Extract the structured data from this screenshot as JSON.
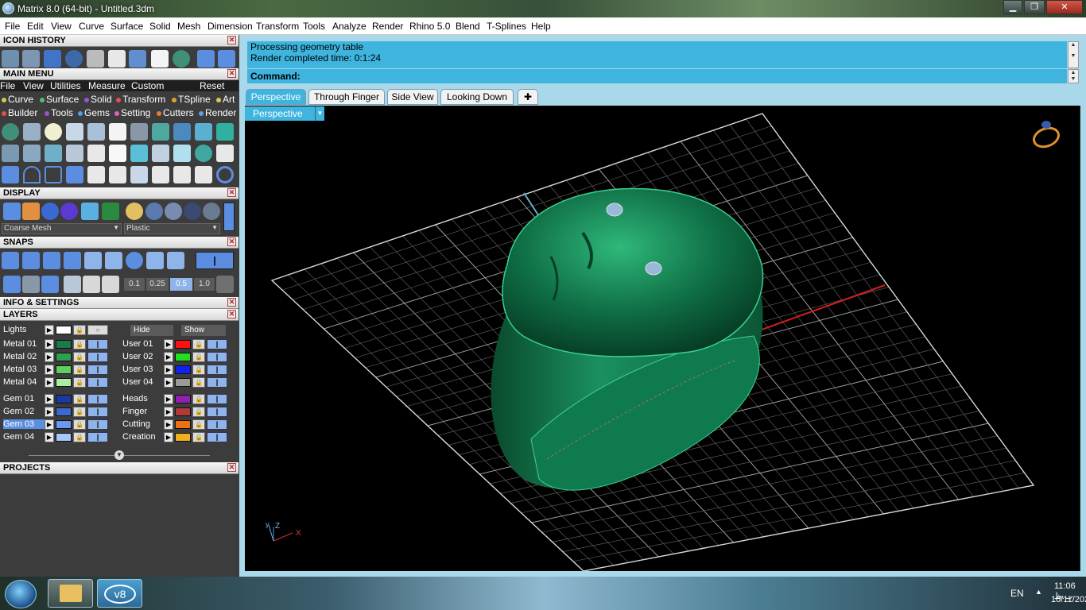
{
  "window": {
    "title": "Matrix 8.0 (64-bit) - Untitled.3dm",
    "min": "▁",
    "restore": "❐",
    "close": "✕"
  },
  "menubar": [
    "File",
    "Edit",
    "View",
    "Curve",
    "Surface",
    "Solid",
    "Mesh",
    "Dimension",
    "Transform",
    "Tools",
    "Analyze",
    "Render",
    "Rhino 5.0",
    "Blend",
    "T-Splines",
    "Help"
  ],
  "panels": {
    "icon_history": "ICON HISTORY",
    "main_menu": "MAIN MENU",
    "display": "DISPLAY",
    "snaps": "SNAPS",
    "info": "INFO & SETTINGS",
    "layers": "LAYERS",
    "projects": "PROJECTS",
    "close": "✕"
  },
  "main_menu": {
    "top": [
      "File",
      "View",
      "Utilities",
      "Measure",
      "Custom"
    ],
    "reset": "Reset",
    "row1": [
      {
        "label": "Curve",
        "color": "#d8c850"
      },
      {
        "label": "Surface",
        "color": "#50c070"
      },
      {
        "label": "Solid",
        "color": "#a050d0"
      },
      {
        "label": "Transform",
        "color": "#e05050"
      },
      {
        "label": "TSpline",
        "color": "#e0a030"
      },
      {
        "label": "Art",
        "color": "#d8c850"
      }
    ],
    "row2": [
      {
        "label": "Builder",
        "color": "#e05050"
      },
      {
        "label": "Tools",
        "color": "#a050d0"
      },
      {
        "label": "Gems",
        "color": "#50a0e0"
      },
      {
        "label": "Setting",
        "color": "#e060c0"
      },
      {
        "label": "Cutters",
        "color": "#e08030"
      },
      {
        "label": "Render",
        "color": "#60a0e0"
      }
    ]
  },
  "display": {
    "mesh": "Coarse Mesh",
    "material": "Plastic"
  },
  "snaps": {
    "values": [
      "0.1",
      "0.25",
      "0.5",
      "1.0"
    ]
  },
  "layers": {
    "lights": "Lights",
    "hide": "Hide",
    "show": "Show",
    "left": [
      {
        "name": "Metal 01",
        "color": "#1a7a4a"
      },
      {
        "name": "Metal 02",
        "color": "#2fa050"
      },
      {
        "name": "Metal 03",
        "color": "#5fd060"
      },
      {
        "name": "Metal 04",
        "color": "#a8f0a0"
      },
      {
        "name": "Gem 01",
        "color": "#1a3aa0"
      },
      {
        "name": "Gem 02",
        "color": "#3a6ad0"
      },
      {
        "name": "Gem 03",
        "color": "#6a9af0"
      },
      {
        "name": "Gem 04",
        "color": "#a8c8f8"
      }
    ],
    "right": [
      {
        "name": "User 01",
        "color": "#ff1010"
      },
      {
        "name": "User 02",
        "color": "#20e020"
      },
      {
        "name": "User 03",
        "color": "#1020f0"
      },
      {
        "name": "User 04",
        "color": "#9a9a9a"
      },
      {
        "name": "Heads",
        "color": "#9020b0"
      },
      {
        "name": "Finger",
        "color": "#b03a3a"
      },
      {
        "name": "Cutting",
        "color": "#f07010"
      },
      {
        "name": "Creation",
        "color": "#f0b020"
      }
    ]
  },
  "command": {
    "log1": "Processing geometry table",
    "log2": "Render completed time: 0:1:24",
    "prompt": "Command:"
  },
  "tabs": [
    "Perspective",
    "Through Finger",
    "Side View",
    "Looking Down",
    "✚"
  ],
  "viewport": {
    "label": "Perspective",
    "axis_z": "Z",
    "axis_x": "X",
    "axis_y": "y"
  },
  "taskbar": {
    "lang": "EN",
    "time": "11:06 ب.ظ",
    "date": "10/11/2022",
    "app_label": "v8"
  }
}
